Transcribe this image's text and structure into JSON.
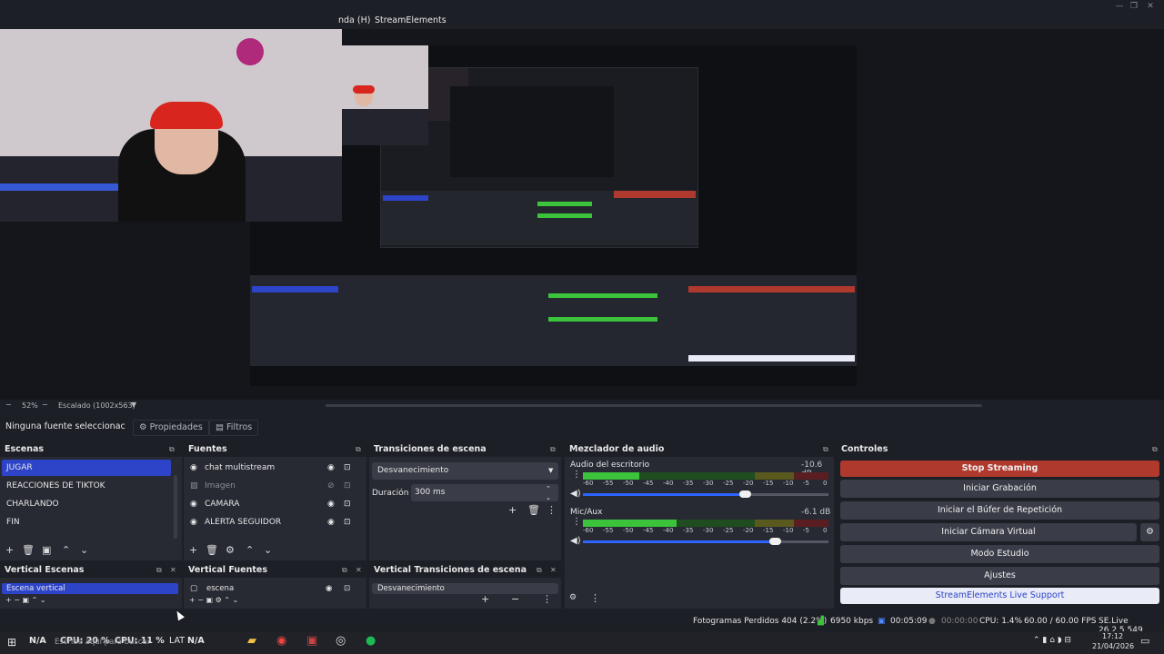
{
  "menu": {
    "items": [
      "nda (H)",
      "StreamElements"
    ]
  },
  "preview": {
    "zoom": "52%",
    "scaling": "Escalado (1002x563)"
  },
  "source_bar": {
    "no_source": "Ninguna fuente seleccionac",
    "properties": "Propiedades",
    "filters": "Filtros"
  },
  "scenes": {
    "title": "Escenas",
    "items": [
      "JUGAR",
      "REACCIONES DE TIKTOK",
      "CHARLANDO",
      "FIN"
    ]
  },
  "sources": {
    "title": "Fuentes",
    "items": [
      "chat multistream",
      "Imagen",
      "CAMARA",
      "ALERTA SEGUIDOR"
    ]
  },
  "transitions": {
    "title": "Transiciones de escena",
    "selected": "Desvanecimiento",
    "duration_label": "Duración",
    "duration_value": "300 ms"
  },
  "mixer": {
    "title": "Mezclador de audio",
    "scale": [
      "-60",
      "-55",
      "-50",
      "-45",
      "-40",
      "-35",
      "-30",
      "-25",
      "-20",
      "-15",
      "-10",
      "-5",
      "0"
    ],
    "channels": [
      {
        "name": "Audio del escritorio",
        "db": "-10.6 dB",
        "level": 0.23,
        "volume": 0.66
      },
      {
        "name": "Mic/Aux",
        "db": "-6.1 dB",
        "level": 0.38,
        "volume": 0.78
      }
    ]
  },
  "controls": {
    "title": "Controles",
    "stop_streaming": "Stop Streaming",
    "start_recording": "Iniciar Grabación",
    "replay_buffer": "Iniciar el Búfer de Repetición",
    "virtual_cam": "Iniciar Cámara Virtual",
    "studio_mode": "Modo Estudio",
    "settings": "Ajustes",
    "support": "StreamElements Live Support"
  },
  "vertical_scenes": {
    "title": "Vertical Escenas",
    "item": "Escena vertical"
  },
  "vertical_sources": {
    "title": "Vertical Fuentes",
    "item": "escena"
  },
  "vertical_transitions": {
    "title": "Vertical Transiciones de escena",
    "item": "Desvanecimiento"
  },
  "status": {
    "dropped": "Fotogramas Perdidos 404 (2.2%)",
    "bitrate": "6950 kbps",
    "stream_time": "00:05:09",
    "rec_time": "00:00:00",
    "cpu": "CPU: 1.4%",
    "fps": "60.00 / 60.00 FPS",
    "version": "SE.Live 26.2.5.549"
  },
  "taskbar": {
    "na1": "N/A",
    "cpu1": "CPU: 20 %",
    "cpu2": "CPU: 11 %",
    "search_placeholder": "Escribe aquí para buscar",
    "lat_label": "LAT",
    "na2": "N/A",
    "time": "17:12",
    "date": "21/04/2026"
  },
  "colors": {
    "accent": "#2d44c9",
    "stop_streaming": "#b0392e",
    "support_bg": "#e9ebf7",
    "meter_green": "#3bc43b",
    "meter_yellow": "#c9b428",
    "meter_red": "#c0272d"
  }
}
